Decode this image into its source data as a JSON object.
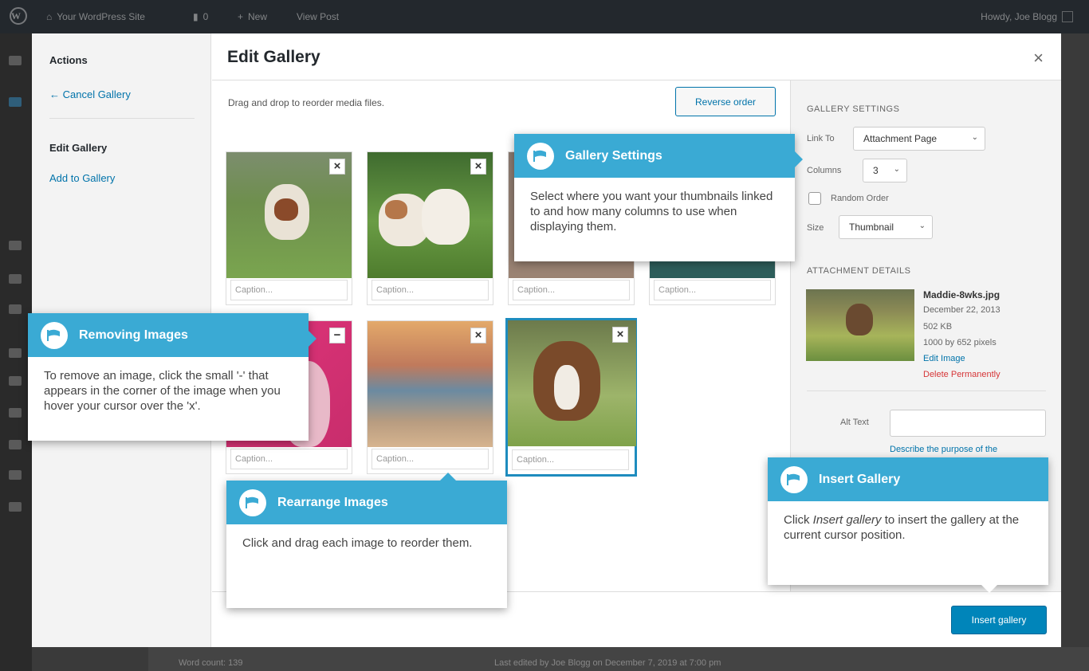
{
  "admin_bar": {
    "site_name": "Your WordPress Site",
    "comments_count": "0",
    "new_label": "New",
    "view_post": "View Post",
    "howdy": "Howdy, Joe Blogg"
  },
  "menu": {
    "heading": "Actions",
    "cancel": "← Cancel Gallery",
    "current": "Edit Gallery",
    "add": "Add to Gallery"
  },
  "modal": {
    "title": "Edit Gallery",
    "close": "×",
    "instructions": "Drag and drop to reorder media files.",
    "reverse_order": "Reverse order",
    "insert_gallery": "Insert gallery"
  },
  "thumbnails": {
    "caption_placeholder": "Caption...",
    "remove_glyph": "×",
    "hover_remove_glyph": "−"
  },
  "gallery_settings": {
    "heading": "Gallery Settings",
    "link_to_label": "Link To",
    "link_to_value": "Attachment Page",
    "columns_label": "Columns",
    "columns_value": "3",
    "random_label": "Random Order",
    "size_label": "Size",
    "size_value": "Thumbnail"
  },
  "attachment": {
    "heading": "Attachment Details",
    "filename": "Maddie-8wks.jpg",
    "date": "December 22, 2013",
    "filesize": "502 KB",
    "dimensions": "1000 by 652 pixels",
    "edit": "Edit Image",
    "delete": "Delete Permanently",
    "alt_label": "Alt Text",
    "describe": "Describe the purpose of the"
  },
  "status": {
    "word_count": "Word count: 139",
    "last_edited": "Last edited by Joe Blogg on December 7, 2019 at 7:00 pm"
  },
  "callouts": {
    "gallery_settings": {
      "title": "Gallery Settings",
      "body": "Select where you want  your thumbnails linked to and how many columns to use when displaying them."
    },
    "removing": {
      "title": "Removing Images",
      "body": "To remove an image, click the small '-' that appears in the corner of the image when you hover your cursor over the 'x'."
    },
    "rearrange": {
      "title": "Rearrange Images",
      "body": "Click and drag each image to reorder them."
    },
    "insert": {
      "title": "Insert Gallery",
      "body_before": "Click ",
      "body_em": "Insert gallery",
      "body_after": " to insert the gallery at the current cursor position."
    }
  },
  "colors": {
    "accent": "#0073aa",
    "callout_header": "#3aaad4",
    "primary_button": "#0085ba",
    "delete": "#d63638"
  }
}
